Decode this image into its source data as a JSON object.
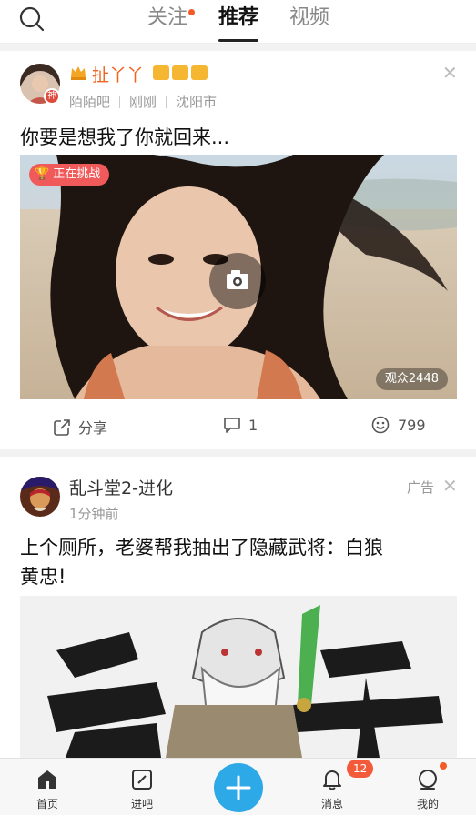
{
  "header": {
    "tabs": [
      {
        "label": "关注",
        "has_dot": true
      },
      {
        "label": "推荐",
        "active": true
      },
      {
        "label": "视频"
      }
    ]
  },
  "post1": {
    "username": "扯丫丫",
    "avatar_badge": "神",
    "meta": [
      "陌陌吧",
      "刚刚",
      "沈阳市"
    ],
    "text": "你要是想我了你就回来...",
    "challenge_badge": "正在挑战",
    "viewers": "观众2448",
    "actions": {
      "share": "分享",
      "comments": "1",
      "likes": "799"
    }
  },
  "post2": {
    "username": "乱斗堂2-进化",
    "time": "1分钟前",
    "ad_label": "广告",
    "text_line1": "上个厕所，老婆帮我抽出了隐藏武将：白狼",
    "text_line2": "黄忠!"
  },
  "bottom_nav": {
    "items": [
      {
        "label": "首页"
      },
      {
        "label": "进吧"
      },
      {
        "label": "消息",
        "badge": "12"
      },
      {
        "label": "我的"
      }
    ]
  },
  "colors": {
    "accent_blue": "#2ea9e8",
    "badge_red": "#f25a3a",
    "username_orange": "#f0641e"
  }
}
